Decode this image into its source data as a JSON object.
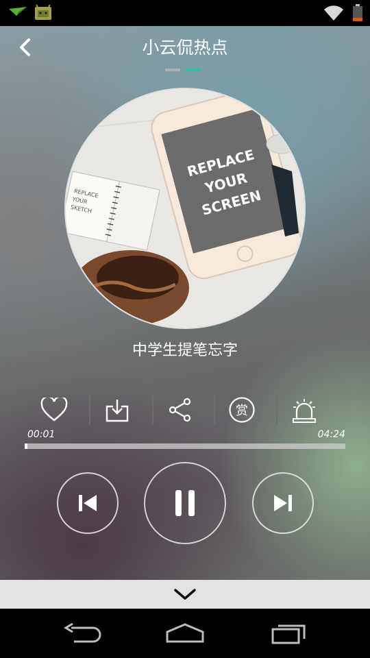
{
  "status_bar": {
    "icons": [
      "notification-app-icon",
      "android-app-icon",
      "wifi-icon",
      "battery-icon"
    ],
    "battery_color": "#e2571e"
  },
  "header": {
    "title": "小云侃热点",
    "back_icon": "chevron-left-icon",
    "page_indicator": {
      "count": 2,
      "active_index": 1,
      "active_color": "#2bbf9f"
    }
  },
  "album_art": {
    "lines": [
      "REPLACE",
      "YOUR",
      "SCREEN"
    ],
    "sketch_lines": [
      "REPLACE",
      "YOUR",
      "SKETCH"
    ]
  },
  "song": {
    "title": "中学生提笔忘字"
  },
  "actions": [
    {
      "name": "like",
      "icon": "heart-icon"
    },
    {
      "name": "download",
      "icon": "download-icon"
    },
    {
      "name": "share",
      "icon": "share-icon"
    },
    {
      "name": "reward",
      "icon": "reward-icon",
      "label": "赏"
    },
    {
      "name": "alarm",
      "icon": "alarm-icon"
    }
  ],
  "playback": {
    "elapsed": "00:01",
    "total": "04:24",
    "progress_fraction": 0.004
  },
  "controls": {
    "prev_icon": "skip-previous-icon",
    "pause_icon": "pause-icon",
    "next_icon": "skip-next-icon"
  },
  "collapse_icon": "chevron-down-icon",
  "nav_bar": {
    "icons": [
      "back-icon",
      "home-icon",
      "recents-icon"
    ]
  }
}
